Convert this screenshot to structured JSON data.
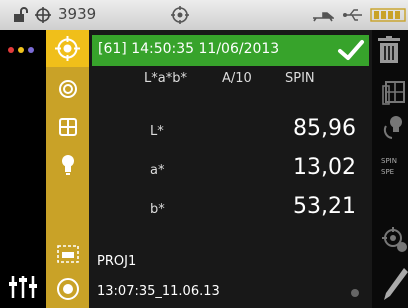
{
  "status": {
    "count": "3939"
  },
  "header": {
    "text": "[61] 14:50:35 11/06/2013"
  },
  "mode": {
    "space": "L*a*b*",
    "illum": "A/10",
    "spec": "SPIN"
  },
  "measurements": [
    {
      "label": "L*",
      "value": "85,96"
    },
    {
      "label": "a*",
      "value": "13,02"
    },
    {
      "label": "b*",
      "value": "53,21"
    }
  ],
  "footer": {
    "project": "PROJ1",
    "timestamp": "13:07:35_11.06.13"
  },
  "right_text": {
    "spin": "SPIN",
    "spe": "SPE"
  },
  "colors": {
    "accent_green": "#37a32b",
    "gold": "#c9a227",
    "gold_selected": "#f0bf1a"
  }
}
